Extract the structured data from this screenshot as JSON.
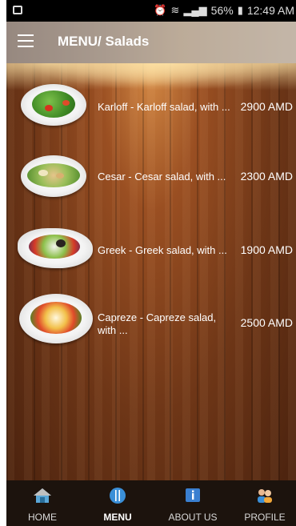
{
  "status_bar": {
    "battery": "56%",
    "time": "12:49 AM"
  },
  "header": {
    "title": "MENU/ Salads"
  },
  "items": [
    {
      "name": "Karloff - Karloff salad, with ...",
      "price": "2900 AMD",
      "icon": "salad-plate-image"
    },
    {
      "name": "Cesar - Cesar salad, with ...",
      "price": "2300 AMD",
      "icon": "salad-plate-image"
    },
    {
      "name": "Greek - Greek salad, with ...",
      "price": "1900 AMD",
      "icon": "salad-plate-image"
    },
    {
      "name": "Capreze - Capreze salad, with ...",
      "price": "2500 AMD",
      "icon": "salad-plate-image"
    }
  ],
  "nav": {
    "home": "HOME",
    "menu": "MENU",
    "about": "ABOUT US",
    "profile": "PROFILE"
  },
  "colors": {
    "nav_bg": "#1c130d",
    "wood": "#6e3617"
  }
}
